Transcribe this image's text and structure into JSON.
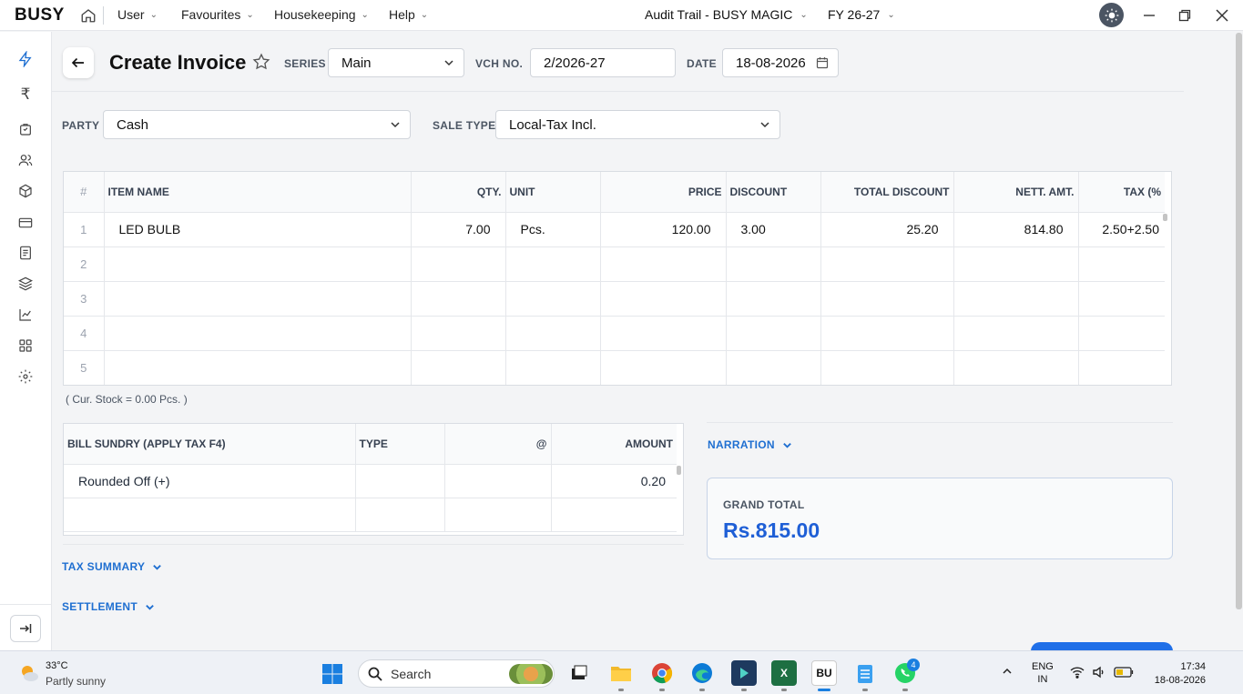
{
  "app": {
    "logo": "BUSY",
    "menus": [
      "User",
      "Favourites",
      "Housekeeping",
      "Help"
    ],
    "company": "Audit Trail - BUSY MAGIC",
    "fy": "FY 26-27"
  },
  "header": {
    "title": "Create Invoice",
    "series_label": "SERIES",
    "series_value": "Main",
    "vch_label": "VCH NO.",
    "vch_value": "2/2026-27",
    "date_label": "DATE",
    "date_value": "18-08-2026",
    "party_label": "PARTY",
    "party_value": "Cash",
    "sale_type_label": "SALE TYPE",
    "sale_type_value": "Local-Tax Incl."
  },
  "items": {
    "columns": [
      "#",
      "ITEM NAME",
      "QTY.",
      "UNIT",
      "PRICE",
      "DISCOUNT",
      "TOTAL DISCOUNT",
      "NETT. AMT.",
      "TAX (%"
    ],
    "rows": [
      {
        "n": "1",
        "name": "LED BULB",
        "qty": "7.00",
        "unit": "Pcs.",
        "price": "120.00",
        "discount": "3.00",
        "total_discount": "25.20",
        "nett": "814.80",
        "tax": "2.50+2.50"
      },
      {
        "n": "2",
        "name": "",
        "qty": "",
        "unit": "",
        "price": "",
        "discount": "",
        "total_discount": "",
        "nett": "",
        "tax": ""
      },
      {
        "n": "3",
        "name": "",
        "qty": "",
        "unit": "",
        "price": "",
        "discount": "",
        "total_discount": "",
        "nett": "",
        "tax": ""
      },
      {
        "n": "4",
        "name": "",
        "qty": "",
        "unit": "",
        "price": "",
        "discount": "",
        "total_discount": "",
        "nett": "",
        "tax": ""
      },
      {
        "n": "5",
        "name": "",
        "qty": "",
        "unit": "",
        "price": "",
        "discount": "",
        "total_discount": "",
        "nett": "",
        "tax": ""
      }
    ],
    "stock_note": "( Cur. Stock = 0.00  Pcs. )"
  },
  "bill_sundry": {
    "columns": [
      "BILL SUNDRY (APPLY TAX F4)",
      "TYPE",
      "@",
      "AMOUNT"
    ],
    "rows": [
      {
        "name": "Rounded Off (+)",
        "type": "",
        "at": "",
        "amount": "0.20"
      },
      {
        "name": "",
        "type": "",
        "at": "",
        "amount": ""
      }
    ]
  },
  "sections": {
    "narration": "NARRATION",
    "tax_summary": "TAX SUMMARY",
    "settlement": "SETTLEMENT"
  },
  "grand_total": {
    "label": "GRAND TOTAL",
    "value": "Rs.815.00"
  },
  "taskbar": {
    "temp": "33°C",
    "weather": "Partly sunny",
    "search_placeholder": "Search",
    "lang1": "ENG",
    "lang2": "IN",
    "time": "17:34",
    "date": "18-08-2026",
    "whatsapp_badge": "4",
    "busy_app": "BU"
  },
  "colors": {
    "accent": "#1f6fd1",
    "grand_total": "#1f5fd6"
  }
}
